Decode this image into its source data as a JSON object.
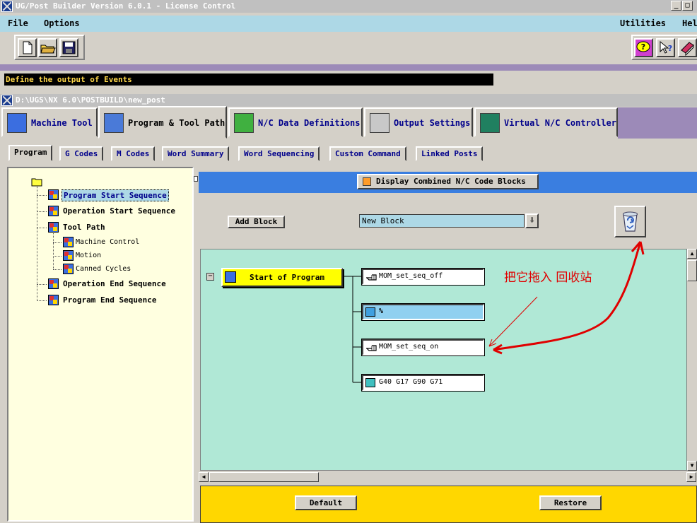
{
  "window": {
    "title": "UG/Post Builder Version 6.0.1 - License Control",
    "sub_title": "D:\\UGS\\NX 6.0\\POSTBUILD\\new_post"
  },
  "menu": {
    "file": "File",
    "options": "Options",
    "utilities": "Utilities",
    "help": "Hel"
  },
  "status_text": "Define the output of Events",
  "main_tabs": [
    {
      "label": "Machine Tool"
    },
    {
      "label": "Program & Tool Path"
    },
    {
      "label": "N/C Data Definitions"
    },
    {
      "label": "Output Settings"
    },
    {
      "label": "Virtual N/C Controller"
    }
  ],
  "sub_tabs": [
    {
      "label": "Program"
    },
    {
      "label": "G Codes"
    },
    {
      "label": "M Codes"
    },
    {
      "label": "Word Summary"
    },
    {
      "label": "Word Sequencing"
    },
    {
      "label": "Custom Command"
    },
    {
      "label": "Linked Posts"
    }
  ],
  "tree": {
    "items": [
      {
        "label": "Program Start Sequence"
      },
      {
        "label": "Operation Start Sequence"
      },
      {
        "label": "Tool Path"
      },
      {
        "label": "Machine Control"
      },
      {
        "label": "Motion"
      },
      {
        "label": "Canned Cycles"
      },
      {
        "label": "Operation End Sequence"
      },
      {
        "label": "Program End Sequence"
      }
    ]
  },
  "display_combined_label": "Display Combined N/C Code Blocks",
  "add_block_label": "Add Block",
  "new_block_value": "New Block",
  "event": {
    "collapse_glyph": "−",
    "label": "Start of Program"
  },
  "blocks": [
    {
      "label": "MOM_set_seq_off"
    },
    {
      "label": "%"
    },
    {
      "label": "MOM_set_seq_on"
    },
    {
      "label": "G40 G17 G90 G71"
    }
  ],
  "annotation": "把它拖入  回收站",
  "buttons": {
    "default": "Default",
    "restore": "Restore"
  },
  "colors": {
    "annotation": "#e00000",
    "canvas": "#b0e8d6",
    "event_block": "#ffff00",
    "action_bar": "#ffd700"
  }
}
